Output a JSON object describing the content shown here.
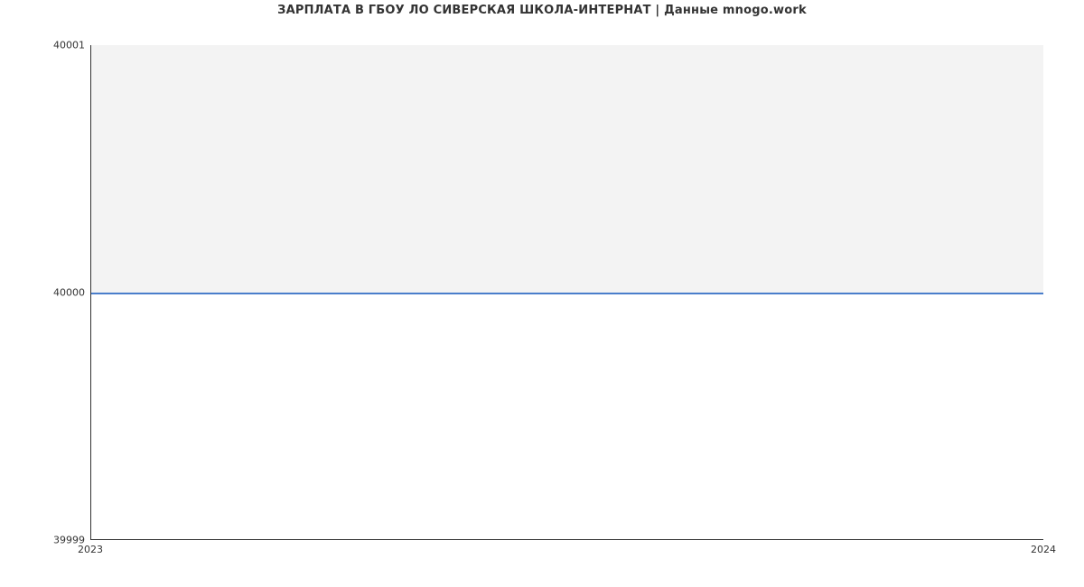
{
  "chart_data": {
    "type": "line",
    "title": "ЗАРПЛАТА В ГБОУ ЛО СИВЕРСКАЯ ШКОЛА-ИНТЕРНАТ | Данные mnogo.work",
    "x": [
      2023,
      2024
    ],
    "values": [
      40000,
      40000
    ],
    "xlabel": "",
    "ylabel": "",
    "ylim": [
      39999,
      40001
    ],
    "x_ticks": [
      "2023",
      "2024"
    ],
    "y_ticks": [
      "39999",
      "40000",
      "40001"
    ]
  }
}
